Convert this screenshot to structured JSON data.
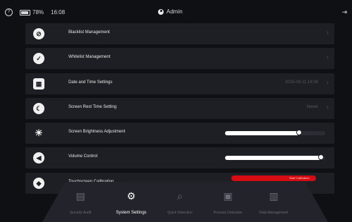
{
  "status": {
    "battery": "78%",
    "time": "16:08",
    "user": "Admin",
    "icons": [
      "help-icon",
      "battery-icon",
      "user-icon",
      "logout-icon"
    ]
  },
  "settings": {
    "items": [
      {
        "label": "Blacklist Management",
        "icon": "blacklist-user-icon"
      },
      {
        "label": "Whitelist Management",
        "icon": "whitelist-user-icon"
      },
      {
        "label": "Date and Time Settings",
        "value": "2025-04-11 16:08",
        "icon": "calendar-icon"
      },
      {
        "label": "Screen Rest Time Setting",
        "value": "Never",
        "icon": "moon-icon"
      },
      {
        "label": "Screen Brightness Adjustment",
        "level": 0.74,
        "icon": "sun-icon"
      },
      {
        "label": "Volume Control",
        "level": 0.96,
        "icon": "speaker-icon"
      },
      {
        "label": "Touchscreen Calibration",
        "action": "Start Calibration",
        "icon": "compass-icon"
      }
    ]
  },
  "dock": {
    "items": [
      {
        "label": "Security Audit",
        "icon": "document-icon",
        "active": false
      },
      {
        "label": "System Settings",
        "icon": "gear-icon",
        "active": true
      },
      {
        "label": "Quick Detection",
        "icon": "search-icon",
        "active": false
      },
      {
        "label": "Process Detection",
        "icon": "process-icon",
        "active": false
      },
      {
        "label": "Data Management",
        "icon": "data-icon",
        "active": false
      }
    ]
  },
  "colors": {
    "background": "#0f1014",
    "row": "#1e1f25",
    "accent_red": "#d40d12",
    "text": "#e8e8e8",
    "muted": "#55575e"
  }
}
